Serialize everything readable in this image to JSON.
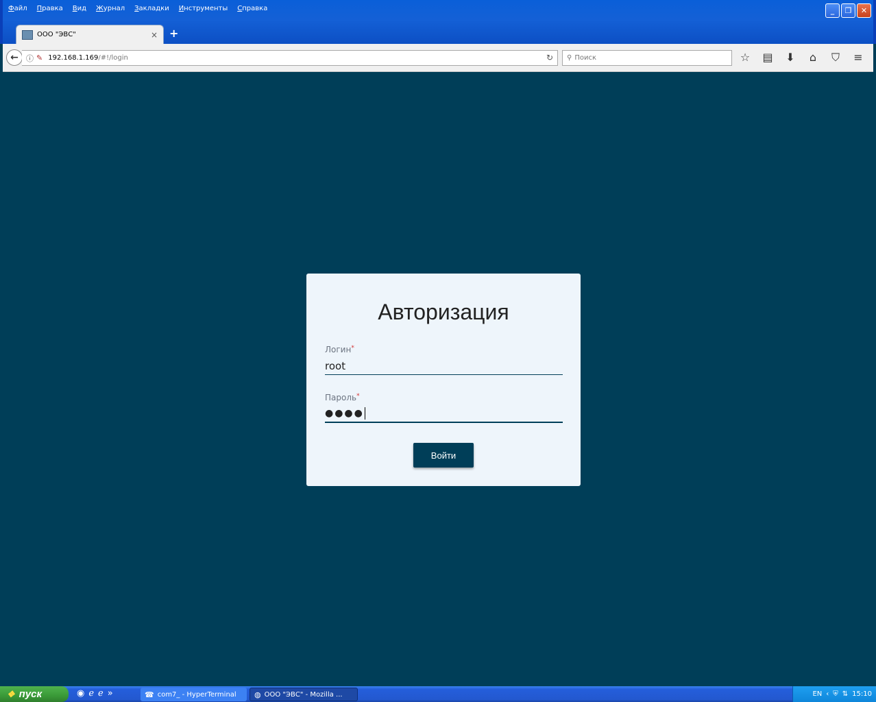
{
  "browser": {
    "menu": [
      "Файл",
      "Правка",
      "Вид",
      "Журнал",
      "Закладки",
      "Инструменты",
      "Справка"
    ],
    "tab_title": "ООО \"ЭВС\"",
    "tab_close": "×",
    "new_tab": "+",
    "url_host": "192.168.1.169",
    "url_path": "/#!/login",
    "search_placeholder": "Поиск",
    "window_controls": {
      "minimize": "_",
      "maximize": "❐",
      "close": "✕"
    }
  },
  "login": {
    "title": "Авторизация",
    "login_label": "Логин",
    "login_value": "root",
    "password_label": "Пароль",
    "password_value": "●●●●",
    "required_mark": "*",
    "submit_label": "Войти"
  },
  "taskbar": {
    "start_label": "пуск",
    "tasks": [
      {
        "label": "com7_ - HyperTerminal"
      },
      {
        "label": "ООО \"ЭВС\" - Mozilla ..."
      }
    ],
    "lang": "EN",
    "clock": "15:10",
    "quick_more": "»"
  },
  "colors": {
    "page_bg": "#003e58",
    "card_bg": "#eef5fb",
    "button_bg": "#003e58",
    "required": "#d32f2f"
  }
}
